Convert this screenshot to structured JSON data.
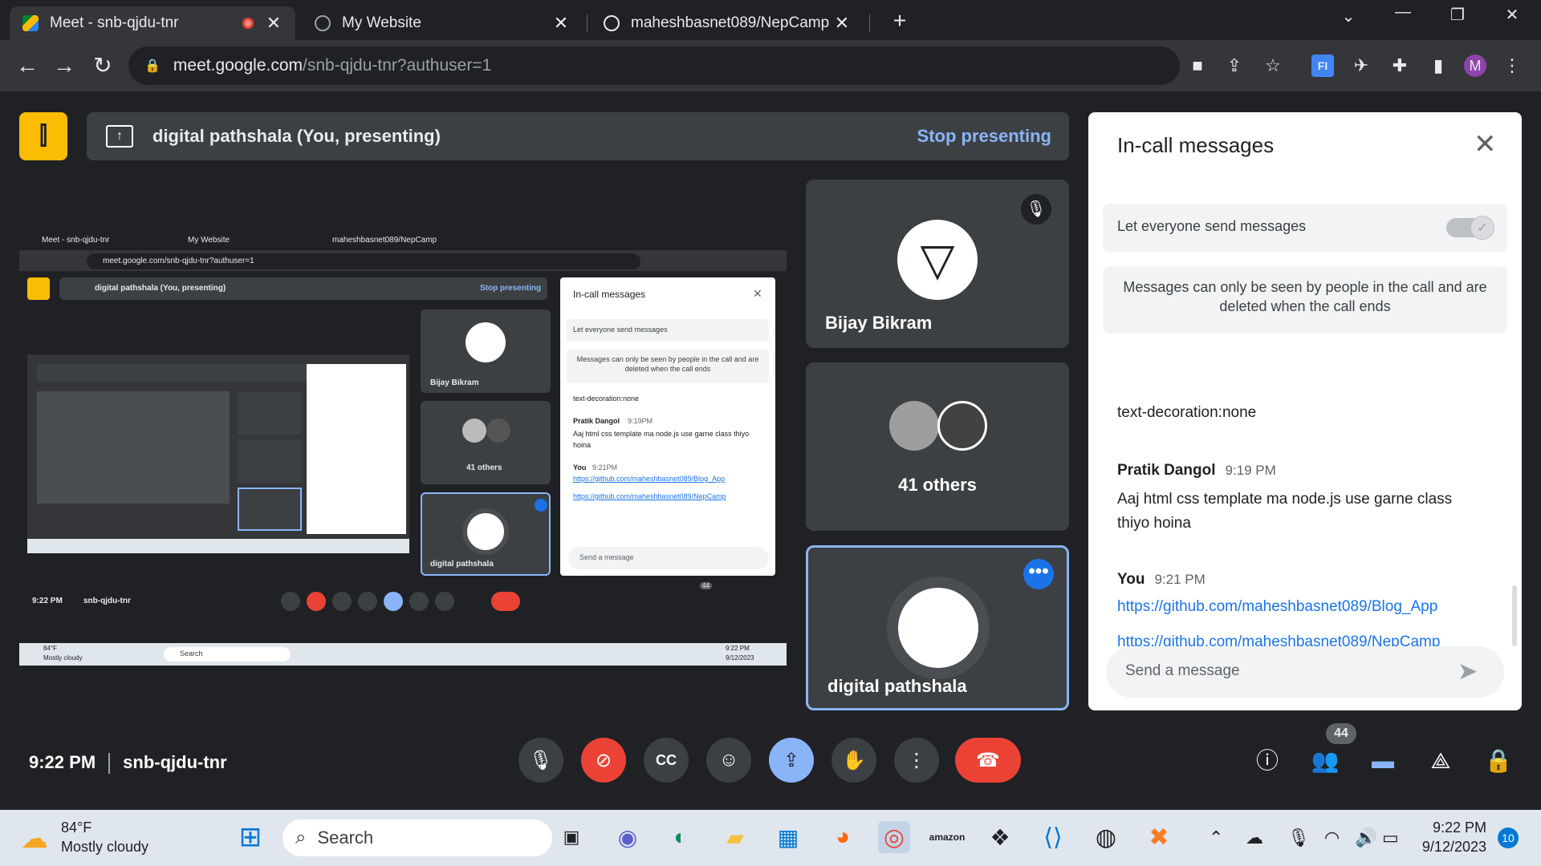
{
  "browser": {
    "tabs": [
      {
        "title": "Meet - snb-qjdu-tnr",
        "active": true,
        "recording": true
      },
      {
        "title": "My Website",
        "active": false
      },
      {
        "title": "maheshbasnet089/NepCamp",
        "active": false
      }
    ],
    "url_host": "meet.google.com",
    "url_path": "/snb-qjdu-tnr?authuser=1",
    "profile_initial": "M"
  },
  "meet": {
    "presenting_title": "digital pathshala (You, presenting)",
    "stop_presenting": "Stop presenting",
    "participants": [
      {
        "name": "Bijay Bikram",
        "muted": true
      },
      {
        "name": "41 others"
      },
      {
        "name": "digital pathshala",
        "speaking": true
      }
    ],
    "clock": "9:22 PM",
    "meeting_code": "snb-qjdu-tnr",
    "people_count": "44"
  },
  "chat": {
    "title": "In-call messages",
    "let_everyone": "Let everyone send messages",
    "info": "Messages can only be seen by people in the call and are deleted when the call ends",
    "partial_msg": "text-decoration:none",
    "messages": [
      {
        "sender": "Pratik Dangol",
        "time": "9:19 PM",
        "text": "Aaj html css template ma node.js use garne class thiyo hoina"
      },
      {
        "sender": "You",
        "time": "9:21 PM",
        "links": [
          "https://github.com/maheshbasnet089/Blog_App",
          "https://github.com/maheshbasnet089/NepCamp"
        ]
      }
    ],
    "placeholder": "Send a message"
  },
  "shared_preview": {
    "tab1": "Meet - snb-qjdu-tnr",
    "tab2": "My Website",
    "tab3": "maheshbasnet089/NepCamp",
    "url": "meet.google.com/snb-qjdu-tnr?authuser=1",
    "presenting": "digital pathshala (You, presenting)",
    "stop": "Stop presenting",
    "chat_title": "In-call messages",
    "let_everyone": "Let everyone send messages",
    "info": "Messages can only be seen by people in the call and are deleted when the call ends",
    "partial": "text-decoration:none",
    "sender1": "Pratik Dangol",
    "time1": "9:19PM",
    "msg1": "Aaj html css template ma node.js use garne class thiyo hoina",
    "sender2": "You",
    "time2": "9:21PM",
    "link1": "https://github.com/maheshbasnet089/Blog_App",
    "link2": "https://github.com/maheshbasnet089/NepCamp",
    "send": "Send a message",
    "p1": "Bijay Bikram",
    "p2": "41 others",
    "p3": "digital pathshala",
    "clock": "9:22 PM",
    "code": "snb-qjdu-tnr",
    "count": "44",
    "weather_temp": "84°F",
    "weather_desc": "Mostly cloudy",
    "search": "Search",
    "tray_time": "9:22 PM",
    "tray_date": "9/12/2023"
  },
  "taskbar": {
    "weather_temp": "84°F",
    "weather_desc": "Mostly cloudy",
    "search": "Search",
    "time": "9:22 PM",
    "date": "9/12/2023",
    "notifications": "10"
  },
  "colors": {
    "accent": "#8ab4f8",
    "danger": "#ea4335",
    "logo": "#fbbc04",
    "link": "#1a73e8"
  }
}
